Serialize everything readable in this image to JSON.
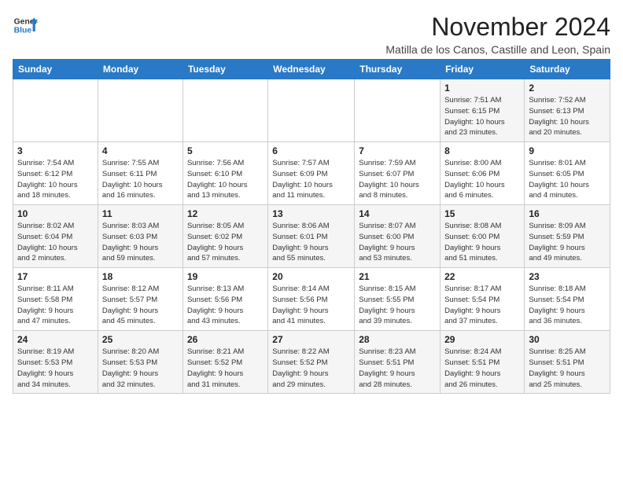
{
  "logo": {
    "line1": "General",
    "line2": "Blue"
  },
  "title": "November 2024",
  "location": "Matilla de los Canos, Castille and Leon, Spain",
  "days_of_week": [
    "Sunday",
    "Monday",
    "Tuesday",
    "Wednesday",
    "Thursday",
    "Friday",
    "Saturday"
  ],
  "weeks": [
    [
      {
        "day": "",
        "info": ""
      },
      {
        "day": "",
        "info": ""
      },
      {
        "day": "",
        "info": ""
      },
      {
        "day": "",
        "info": ""
      },
      {
        "day": "",
        "info": ""
      },
      {
        "day": "1",
        "info": "Sunrise: 7:51 AM\nSunset: 6:15 PM\nDaylight: 10 hours\nand 23 minutes."
      },
      {
        "day": "2",
        "info": "Sunrise: 7:52 AM\nSunset: 6:13 PM\nDaylight: 10 hours\nand 20 minutes."
      }
    ],
    [
      {
        "day": "3",
        "info": "Sunrise: 7:54 AM\nSunset: 6:12 PM\nDaylight: 10 hours\nand 18 minutes."
      },
      {
        "day": "4",
        "info": "Sunrise: 7:55 AM\nSunset: 6:11 PM\nDaylight: 10 hours\nand 16 minutes."
      },
      {
        "day": "5",
        "info": "Sunrise: 7:56 AM\nSunset: 6:10 PM\nDaylight: 10 hours\nand 13 minutes."
      },
      {
        "day": "6",
        "info": "Sunrise: 7:57 AM\nSunset: 6:09 PM\nDaylight: 10 hours\nand 11 minutes."
      },
      {
        "day": "7",
        "info": "Sunrise: 7:59 AM\nSunset: 6:07 PM\nDaylight: 10 hours\nand 8 minutes."
      },
      {
        "day": "8",
        "info": "Sunrise: 8:00 AM\nSunset: 6:06 PM\nDaylight: 10 hours\nand 6 minutes."
      },
      {
        "day": "9",
        "info": "Sunrise: 8:01 AM\nSunset: 6:05 PM\nDaylight: 10 hours\nand 4 minutes."
      }
    ],
    [
      {
        "day": "10",
        "info": "Sunrise: 8:02 AM\nSunset: 6:04 PM\nDaylight: 10 hours\nand 2 minutes."
      },
      {
        "day": "11",
        "info": "Sunrise: 8:03 AM\nSunset: 6:03 PM\nDaylight: 9 hours\nand 59 minutes."
      },
      {
        "day": "12",
        "info": "Sunrise: 8:05 AM\nSunset: 6:02 PM\nDaylight: 9 hours\nand 57 minutes."
      },
      {
        "day": "13",
        "info": "Sunrise: 8:06 AM\nSunset: 6:01 PM\nDaylight: 9 hours\nand 55 minutes."
      },
      {
        "day": "14",
        "info": "Sunrise: 8:07 AM\nSunset: 6:00 PM\nDaylight: 9 hours\nand 53 minutes."
      },
      {
        "day": "15",
        "info": "Sunrise: 8:08 AM\nSunset: 6:00 PM\nDaylight: 9 hours\nand 51 minutes."
      },
      {
        "day": "16",
        "info": "Sunrise: 8:09 AM\nSunset: 5:59 PM\nDaylight: 9 hours\nand 49 minutes."
      }
    ],
    [
      {
        "day": "17",
        "info": "Sunrise: 8:11 AM\nSunset: 5:58 PM\nDaylight: 9 hours\nand 47 minutes."
      },
      {
        "day": "18",
        "info": "Sunrise: 8:12 AM\nSunset: 5:57 PM\nDaylight: 9 hours\nand 45 minutes."
      },
      {
        "day": "19",
        "info": "Sunrise: 8:13 AM\nSunset: 5:56 PM\nDaylight: 9 hours\nand 43 minutes."
      },
      {
        "day": "20",
        "info": "Sunrise: 8:14 AM\nSunset: 5:56 PM\nDaylight: 9 hours\nand 41 minutes."
      },
      {
        "day": "21",
        "info": "Sunrise: 8:15 AM\nSunset: 5:55 PM\nDaylight: 9 hours\nand 39 minutes."
      },
      {
        "day": "22",
        "info": "Sunrise: 8:17 AM\nSunset: 5:54 PM\nDaylight: 9 hours\nand 37 minutes."
      },
      {
        "day": "23",
        "info": "Sunrise: 8:18 AM\nSunset: 5:54 PM\nDaylight: 9 hours\nand 36 minutes."
      }
    ],
    [
      {
        "day": "24",
        "info": "Sunrise: 8:19 AM\nSunset: 5:53 PM\nDaylight: 9 hours\nand 34 minutes."
      },
      {
        "day": "25",
        "info": "Sunrise: 8:20 AM\nSunset: 5:53 PM\nDaylight: 9 hours\nand 32 minutes."
      },
      {
        "day": "26",
        "info": "Sunrise: 8:21 AM\nSunset: 5:52 PM\nDaylight: 9 hours\nand 31 minutes."
      },
      {
        "day": "27",
        "info": "Sunrise: 8:22 AM\nSunset: 5:52 PM\nDaylight: 9 hours\nand 29 minutes."
      },
      {
        "day": "28",
        "info": "Sunrise: 8:23 AM\nSunset: 5:51 PM\nDaylight: 9 hours\nand 28 minutes."
      },
      {
        "day": "29",
        "info": "Sunrise: 8:24 AM\nSunset: 5:51 PM\nDaylight: 9 hours\nand 26 minutes."
      },
      {
        "day": "30",
        "info": "Sunrise: 8:25 AM\nSunset: 5:51 PM\nDaylight: 9 hours\nand 25 minutes."
      }
    ]
  ]
}
